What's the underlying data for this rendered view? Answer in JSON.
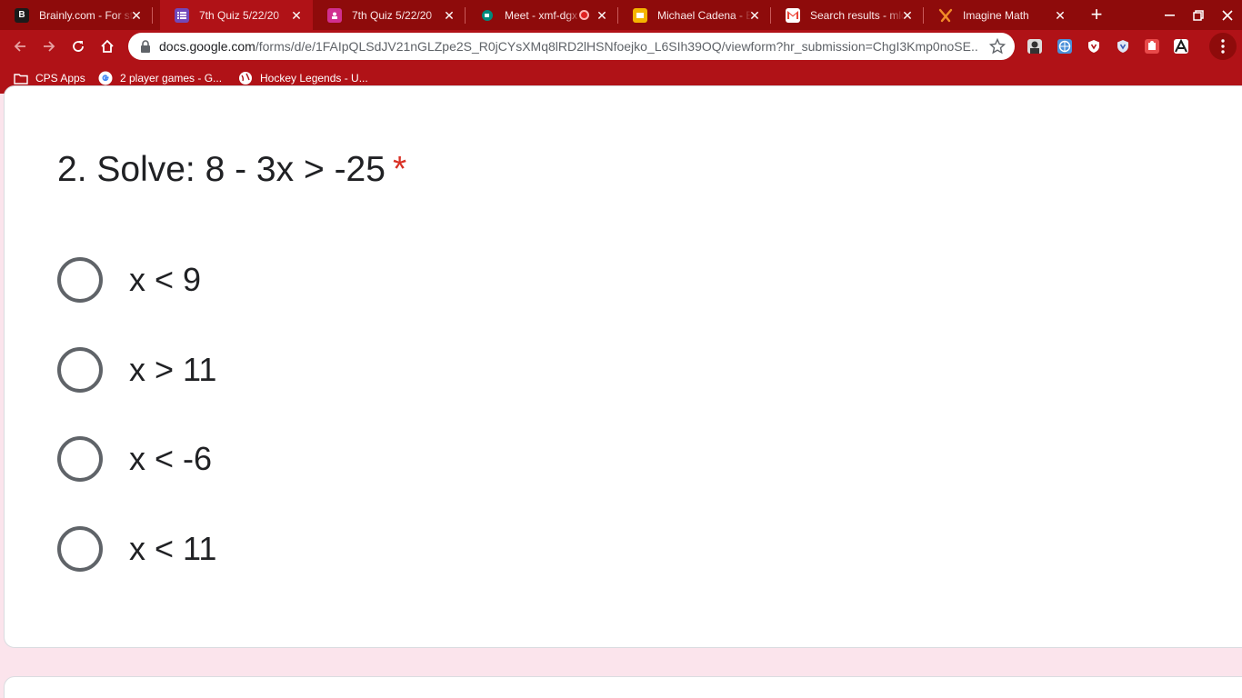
{
  "tabs": [
    {
      "title": "Brainly.com - For st",
      "favicon": "brainly-icon",
      "color": "#1b1b1b",
      "active": false
    },
    {
      "title": "7th Quiz 5/22/20",
      "favicon": "google-forms-icon",
      "color": "#7248b9",
      "active": true
    },
    {
      "title": "7th Quiz 5/22/20",
      "favicon": "google-classroom-icon",
      "color": "#d12f8f",
      "active": false
    },
    {
      "title": "Meet - xmf-dgx",
      "favicon": "google-meet-icon",
      "color": "#00897b",
      "active": false,
      "recording": true
    },
    {
      "title": "Michael Cadena - E",
      "favicon": "google-slides-icon",
      "color": "#f4b400",
      "active": false
    },
    {
      "title": "Search results - mlc",
      "favicon": "gmail-icon",
      "color": "#ea4335",
      "active": false
    },
    {
      "title": "Imagine Math",
      "favicon": "imagine-math-icon",
      "color": "#f28c28",
      "active": false
    }
  ],
  "toolbar": {
    "url_host": "docs.google.com",
    "url_path": "/forms/d/e/1FAIpQLSdJV21nGLZpe2S_R0jCYsXMq8lRD2lHSNfoejko_L6SIh39OQ/viewform?hr_submission=ChgI3Kmp0noSE..."
  },
  "bookmarks": [
    {
      "label": "CPS Apps",
      "icon": "folder-icon"
    },
    {
      "label": "2 player games - G...",
      "icon": "google-icon"
    },
    {
      "label": "Hockey Legends - U...",
      "icon": "globe-icon"
    }
  ],
  "question": {
    "text": "2. Solve: 8 - 3x > -25",
    "required_mark": "*"
  },
  "options": [
    {
      "label": "x < 9"
    },
    {
      "label": "x > 11"
    },
    {
      "label": "x < -6"
    },
    {
      "label": "x < 11"
    }
  ],
  "colors": {
    "chrome_dark": "#8e0b0b",
    "chrome_main": "#b01217",
    "page_background": "#fbe4ec",
    "required": "#d93025"
  }
}
